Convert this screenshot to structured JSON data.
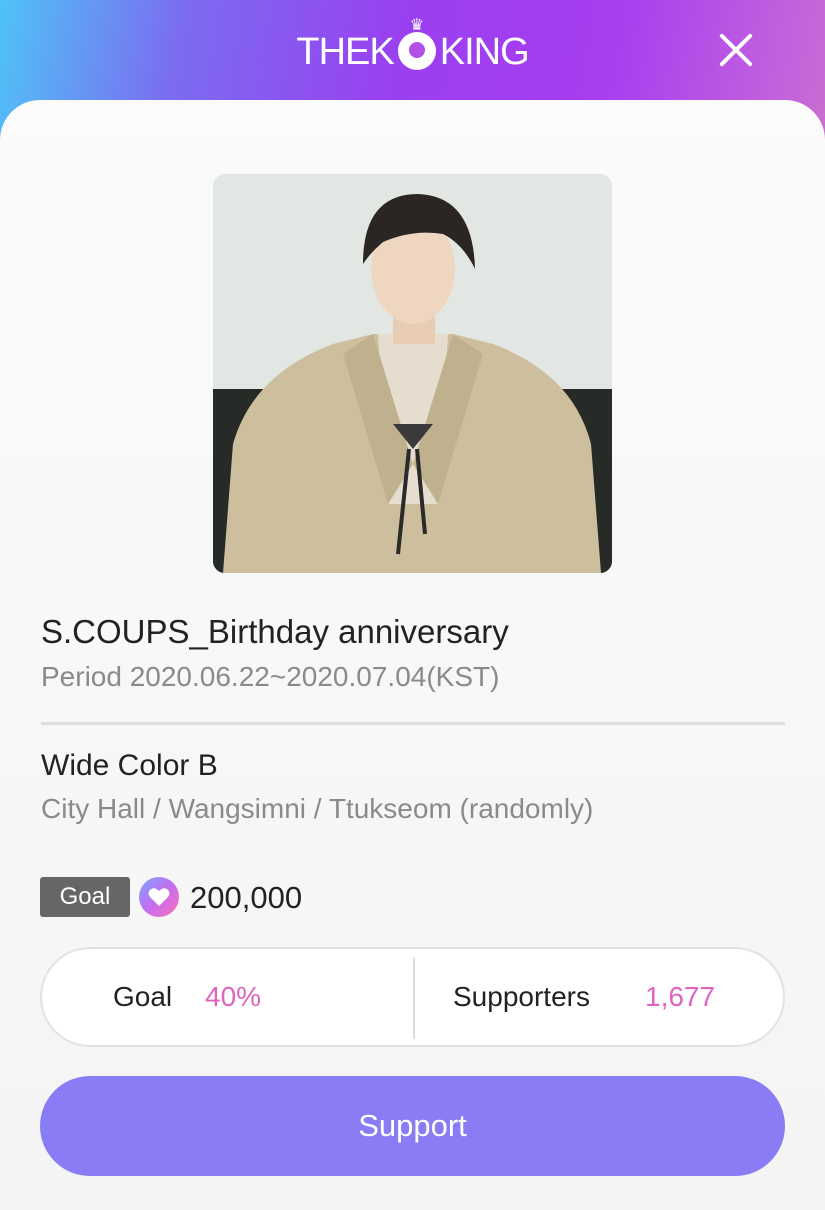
{
  "header": {
    "logo_left": "THEK",
    "logo_right": "KING",
    "close_icon": "close-icon"
  },
  "event": {
    "title": "S.COUPS_Birthday anniversary",
    "period": "Period 2020.06.22~2020.07.04(KST)"
  },
  "item": {
    "name": "Wide Color B",
    "description": "City Hall / Wangsimni / Ttukseom (randomly)"
  },
  "goal": {
    "badge_label": "Goal",
    "icon": "heart-icon",
    "amount": "200,000"
  },
  "stats": {
    "goal_label": "Goal",
    "goal_value": "40%",
    "supporters_label": "Supporters",
    "supporters_value": "1,677"
  },
  "actions": {
    "support_label": "Support"
  },
  "colors": {
    "accent_pink": "#e063c0",
    "button_purple": "#8a7cf5"
  }
}
